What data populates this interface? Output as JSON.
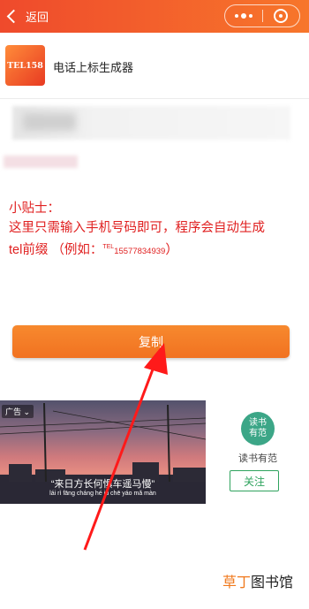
{
  "topbar": {
    "back_label": "返回"
  },
  "app": {
    "logo_text": "TEL158",
    "title": "电话上标生成器"
  },
  "tips": {
    "heading": "小贴士：",
    "body": "这里只需输入手机号码即可，程序会自动生成",
    "prefix": "tel前缀 （例如：",
    "example_sup": "TEL",
    "example_number": "15577834939",
    "suffix": "）"
  },
  "copy_button": {
    "label": "复制"
  },
  "ad": {
    "tag": "广告",
    "quote": "“来日方长何惧车遥马慢”",
    "pinyin": "lái rì fāng cháng hé jù chē yáo mǎ màn",
    "brand_logo": "读书\n有范",
    "brand_name": "读书有范",
    "follow_label": "关注"
  },
  "watermark": {
    "part1": "草丁",
    "part2": "图书馆"
  },
  "colors": {
    "brand_orange": "#f17221",
    "tip_red": "#e02020",
    "follow_green": "#2fa35e"
  }
}
